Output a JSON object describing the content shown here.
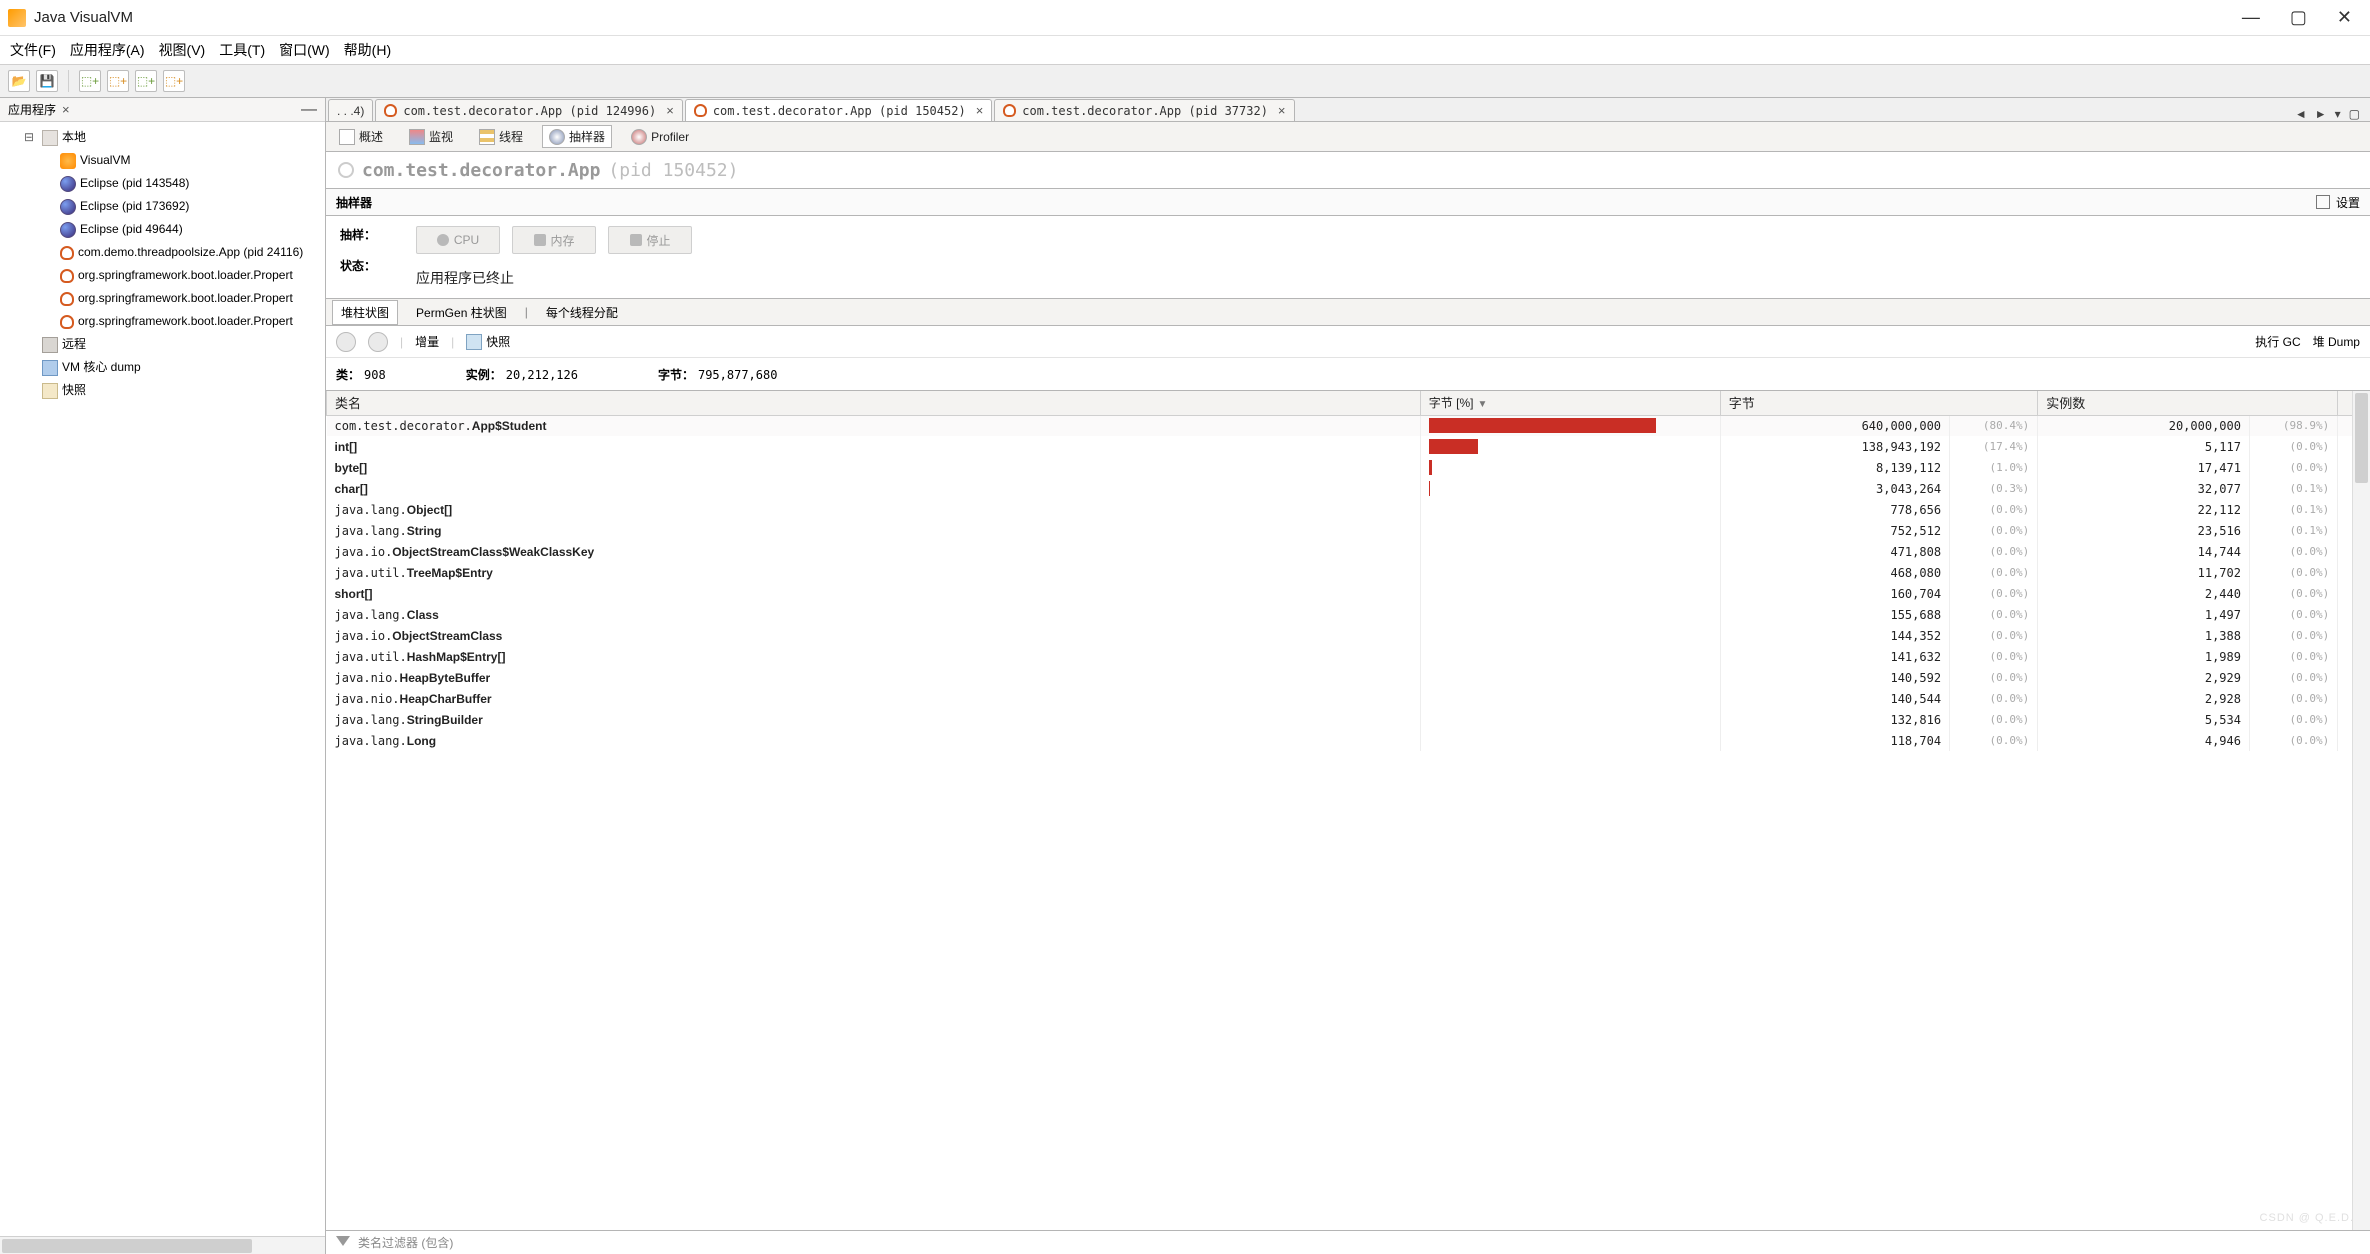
{
  "titlebar": {
    "app_name": "Java VisualVM"
  },
  "menubar": {
    "items": [
      "文件(F)",
      "应用程序(A)",
      "视图(V)",
      "工具(T)",
      "窗口(W)",
      "帮助(H)"
    ]
  },
  "sidebar": {
    "tab_label": "应用程序",
    "nodes": {
      "local": "本地",
      "visualvm": "VisualVM",
      "eclipse1": "Eclipse (pid 143548)",
      "eclipse2": "Eclipse (pid 173692)",
      "eclipse3": "Eclipse (pid 49644)",
      "app_demo": "com.demo.threadpoolsize.App (pid 24116)",
      "spring1": "org.springframework.boot.loader.Propert",
      "spring2": "org.springframework.boot.loader.Propert",
      "spring3": "org.springframework.boot.loader.Propert",
      "remote": "远程",
      "coredump": "VM 核心 dump",
      "snapshot": "快照"
    }
  },
  "doc_tabs": {
    "overflow": ". . .4)",
    "tab1": "com.test.decorator.App (pid 124996)",
    "tab2": "com.test.decorator.App (pid 150452)",
    "tab3": "com.test.decorator.App (pid 37732)"
  },
  "views": {
    "overview": "概述",
    "monitor": "监视",
    "threads": "线程",
    "sampler": "抽样器",
    "profiler": "Profiler"
  },
  "process": {
    "name": "com.test.decorator.App",
    "pid": "(pid 150452)"
  },
  "sampler": {
    "header": "抽样器",
    "settings_label": "设置",
    "sample_label": "抽样：",
    "status_label": "状态：",
    "status_value": "应用程序已终止",
    "btn_cpu": "CPU",
    "btn_mem": "内存",
    "btn_stop": "停止"
  },
  "subtabs": {
    "heap": "堆柱状图",
    "permgen": "PermGen 柱状图",
    "threads": "每个线程分配"
  },
  "toolrow": {
    "delta": "增量",
    "snapshot": "快照",
    "gc": "执行 GC",
    "heapdump": "堆 Dump"
  },
  "stats": {
    "classes_label": "类：",
    "classes": "908",
    "instances_label": "实例：",
    "instances": "20,212,126",
    "bytes_label": "字节：",
    "bytes": "795,877,680"
  },
  "columns": {
    "name": "类名",
    "bytes_pct": "字节 [%]",
    "bytes": "字节",
    "instances": "实例数"
  },
  "rows": [
    {
      "pre": "com.test.decorator.",
      "b": "App$Student",
      "bar": 80.4,
      "bytes": "640,000,000",
      "bpct": "(80.4%)",
      "inst": "20,000,000",
      "ipct": "(98.9%)"
    },
    {
      "pre": "",
      "b": "int[]",
      "bar": 17.4,
      "bytes": "138,943,192",
      "bpct": "(17.4%)",
      "inst": "5,117",
      "ipct": "(0.0%)"
    },
    {
      "pre": "",
      "b": "byte[]",
      "bar": 1.0,
      "bytes": "8,139,112",
      "bpct": "(1.0%)",
      "inst": "17,471",
      "ipct": "(0.0%)"
    },
    {
      "pre": "",
      "b": "char[]",
      "bar": 0.3,
      "bytes": "3,043,264",
      "bpct": "(0.3%)",
      "inst": "32,077",
      "ipct": "(0.1%)"
    },
    {
      "pre": "java.lang.",
      "b": "Object[]",
      "bar": 0,
      "bytes": "778,656",
      "bpct": "(0.0%)",
      "inst": "22,112",
      "ipct": "(0.1%)"
    },
    {
      "pre": "java.lang.",
      "b": "String",
      "bar": 0,
      "bytes": "752,512",
      "bpct": "(0.0%)",
      "inst": "23,516",
      "ipct": "(0.1%)"
    },
    {
      "pre": "java.io.",
      "b": "ObjectStreamClass$WeakClassKey",
      "bar": 0,
      "bytes": "471,808",
      "bpct": "(0.0%)",
      "inst": "14,744",
      "ipct": "(0.0%)"
    },
    {
      "pre": "java.util.",
      "b": "TreeMap$Entry",
      "bar": 0,
      "bytes": "468,080",
      "bpct": "(0.0%)",
      "inst": "11,702",
      "ipct": "(0.0%)"
    },
    {
      "pre": "",
      "b": "short[]",
      "bar": 0,
      "bytes": "160,704",
      "bpct": "(0.0%)",
      "inst": "2,440",
      "ipct": "(0.0%)"
    },
    {
      "pre": "java.lang.",
      "b": "Class",
      "bar": 0,
      "bytes": "155,688",
      "bpct": "(0.0%)",
      "inst": "1,497",
      "ipct": "(0.0%)"
    },
    {
      "pre": "java.io.",
      "b": "ObjectStreamClass",
      "bar": 0,
      "bytes": "144,352",
      "bpct": "(0.0%)",
      "inst": "1,388",
      "ipct": "(0.0%)"
    },
    {
      "pre": "java.util.",
      "b": "HashMap$Entry[]",
      "bar": 0,
      "bytes": "141,632",
      "bpct": "(0.0%)",
      "inst": "1,989",
      "ipct": "(0.0%)"
    },
    {
      "pre": "java.nio.",
      "b": "HeapByteBuffer",
      "bar": 0,
      "bytes": "140,592",
      "bpct": "(0.0%)",
      "inst": "2,929",
      "ipct": "(0.0%)"
    },
    {
      "pre": "java.nio.",
      "b": "HeapCharBuffer",
      "bar": 0,
      "bytes": "140,544",
      "bpct": "(0.0%)",
      "inst": "2,928",
      "ipct": "(0.0%)"
    },
    {
      "pre": "java.lang.",
      "b": "StringBuilder",
      "bar": 0,
      "bytes": "132,816",
      "bpct": "(0.0%)",
      "inst": "5,534",
      "ipct": "(0.0%)"
    },
    {
      "pre": "java.lang.",
      "b": "Long",
      "bar": 0,
      "bytes": "118,704",
      "bpct": "(0.0%)",
      "inst": "4,946",
      "ipct": "(0.0%)"
    }
  ],
  "filter": {
    "placeholder": "类名过滤器 (包含)"
  },
  "watermark": "CSDN @ Q.E.D."
}
